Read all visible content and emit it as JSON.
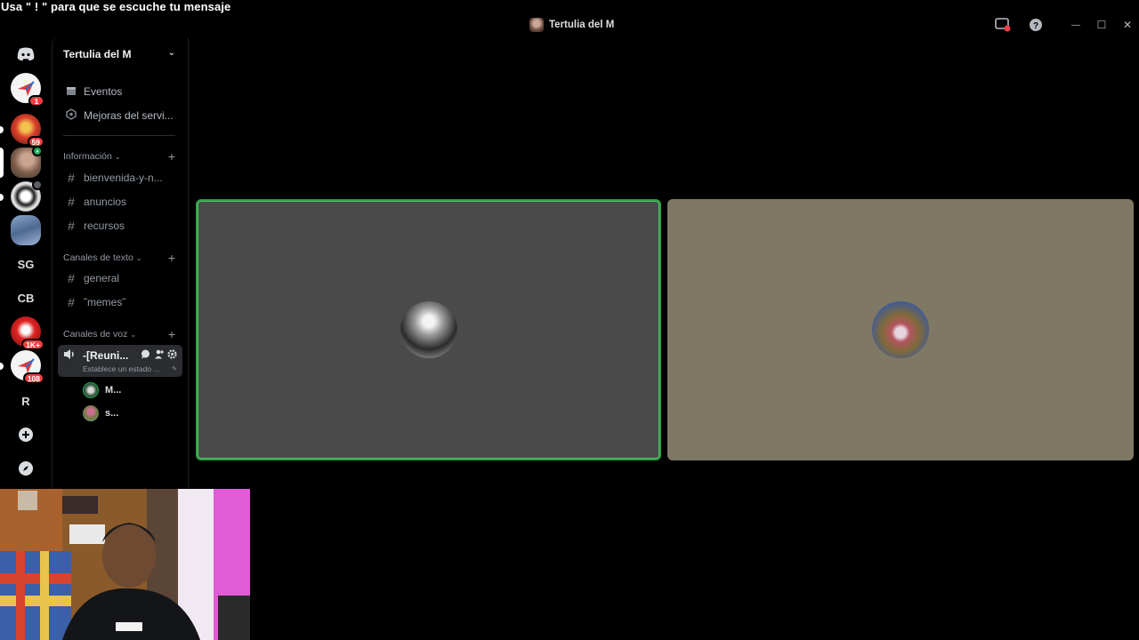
{
  "overlay": {
    "text": "Usa \" ! \" para que se escuche tu mensaje"
  },
  "window": {
    "title": "Tertulia del M",
    "minimize": "—",
    "maximize": "☐",
    "close": "✕"
  },
  "guilds": {
    "items": [
      {
        "name": "discord-home",
        "label": ""
      },
      {
        "name": "server-1",
        "badge": "1"
      },
      {
        "name": "server-2",
        "badge": "59"
      },
      {
        "name": "server-tertulia",
        "badge": ""
      },
      {
        "name": "server-4",
        "badge": ""
      },
      {
        "name": "server-5",
        "badge": ""
      },
      {
        "name": "server-sg",
        "label": "SG"
      },
      {
        "name": "server-cb",
        "label": "CB"
      },
      {
        "name": "server-9",
        "badge": "1K+"
      },
      {
        "name": "server-10",
        "badge": "108"
      },
      {
        "name": "server-r",
        "label": "R"
      }
    ]
  },
  "sidebar": {
    "server_name": "Tertulia del M",
    "events": "Eventos",
    "boosts": "Mejoras del servi...",
    "categories": [
      {
        "label": "Información",
        "channels": [
          "bienvenida-y-n...",
          "anuncios",
          "recursos"
        ]
      },
      {
        "label": "Canales de texto",
        "channels": [
          "general",
          "˜memes˜"
        ]
      },
      {
        "label": "Canales de voz"
      }
    ],
    "voice_channel": {
      "name": "-[Reuni...",
      "status": "Establece un estado ..."
    },
    "voice_users": [
      "M...",
      "s..."
    ]
  },
  "colors": {
    "speaking_border": "#2ea043",
    "tile1_bg": "#4a4a4a",
    "tile2_bg": "#7f7864",
    "badge_red": "#f23f43"
  }
}
